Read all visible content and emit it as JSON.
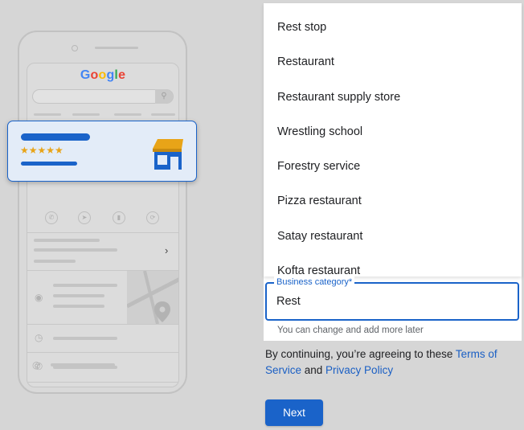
{
  "illustration": {
    "logo_text": "Google",
    "stars": "★★★★★",
    "colors": {
      "brand_blue": "#1a63c9",
      "star_gold": "#e8a418"
    }
  },
  "dropdown": {
    "options": [
      {
        "label": "Rest stop"
      },
      {
        "label": "Restaurant"
      },
      {
        "label": "Restaurant supply store"
      },
      {
        "label": "Wrestling school"
      },
      {
        "label": "Forestry service"
      },
      {
        "label": "Pizza restaurant"
      },
      {
        "label": "Satay restaurant"
      },
      {
        "label": "Kofta restaurant"
      }
    ]
  },
  "category_field": {
    "label": "Business category*",
    "value": "Rest",
    "helper": "You can change and add more later"
  },
  "terms": {
    "prefix": "By continuing, you’re agreeing to these ",
    "terms_link": "Terms of Service",
    "middle": " and ",
    "privacy_link": "Privacy Policy"
  },
  "actions": {
    "next_label": "Next"
  }
}
